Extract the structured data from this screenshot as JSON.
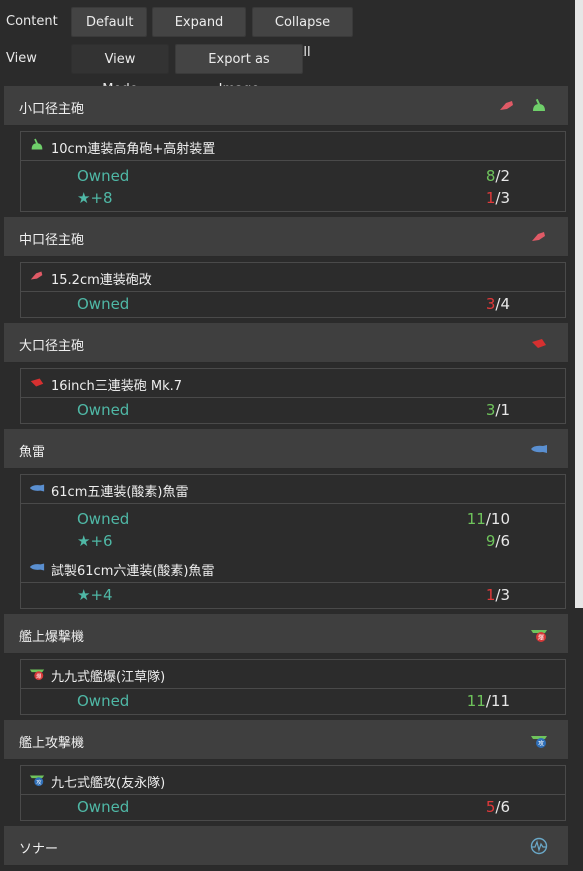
{
  "topbar": {
    "content_label": "Content",
    "view_label": "View",
    "buttons": {
      "default": "Default",
      "expand_all": "Expand All",
      "collapse_all": "Collapse All",
      "view_mode": "View Mode",
      "export_image": "Export as Image"
    }
  },
  "categories": [
    {
      "title": "小口径主砲",
      "items": [
        {
          "name": "10cm連装高角砲+高射装置",
          "stats": [
            {
              "label": "Owned",
              "have": "8",
              "need": "/2"
            },
            {
              "label": "★+8",
              "have": "1",
              "need": "/3"
            }
          ]
        }
      ]
    },
    {
      "title": "中口径主砲",
      "items": [
        {
          "name": "15.2cm連装砲改",
          "stats": [
            {
              "label": "Owned",
              "have": "3",
              "need": "/4"
            }
          ]
        }
      ]
    },
    {
      "title": "大口径主砲",
      "items": [
        {
          "name": "16inch三連装砲 Mk.7",
          "stats": [
            {
              "label": "Owned",
              "have": "3",
              "need": "/1"
            }
          ]
        }
      ]
    },
    {
      "title": "魚雷",
      "items": [
        {
          "name": "61cm五連装(酸素)魚雷",
          "stats": [
            {
              "label": "Owned",
              "have": "11",
              "need": "/10"
            },
            {
              "label": "★+6",
              "have": "9",
              "need": "/6"
            }
          ]
        },
        {
          "name": "試製61cm六連装(酸素)魚雷",
          "stats": [
            {
              "label": "★+4",
              "have": "1",
              "need": "/3"
            }
          ]
        }
      ]
    },
    {
      "title": "艦上爆撃機",
      "items": [
        {
          "name": "九九式艦爆(江草隊)",
          "stats": [
            {
              "label": "Owned",
              "have": "11",
              "need": "/11"
            }
          ]
        }
      ]
    },
    {
      "title": "艦上攻撃機",
      "items": [
        {
          "name": "九七式艦攻(友永隊)",
          "stats": [
            {
              "label": "Owned",
              "have": "5",
              "need": "/6"
            }
          ]
        }
      ]
    },
    {
      "title": "ソナー",
      "items": []
    }
  ],
  "colors": {
    "ok": "#6fc45c",
    "short": "#e0393a",
    "label": "#4fb8a6"
  }
}
